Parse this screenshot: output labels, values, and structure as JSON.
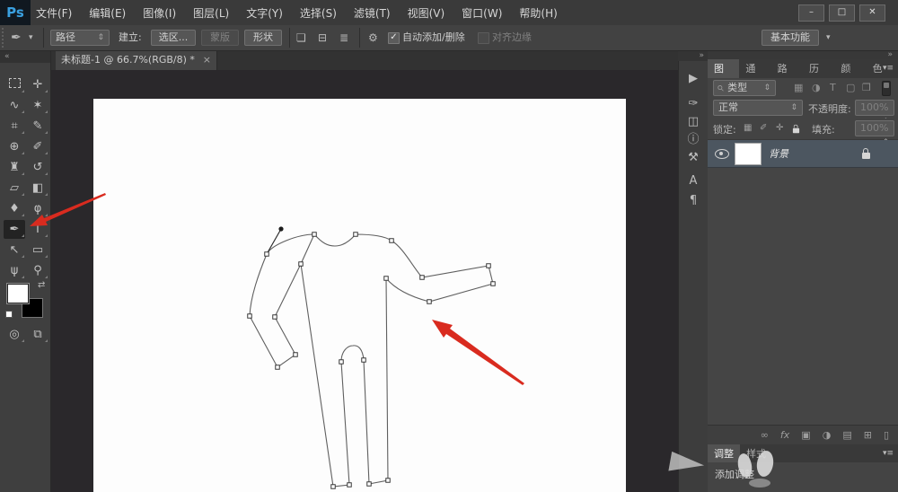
{
  "window": {
    "controls": {
      "minimize": "–",
      "maximize": "□",
      "close": "✕"
    }
  },
  "menubar": {
    "logo": "Ps",
    "items": [
      {
        "label": "文件(F)"
      },
      {
        "label": "编辑(E)"
      },
      {
        "label": "图像(I)"
      },
      {
        "label": "图层(L)"
      },
      {
        "label": "文字(Y)"
      },
      {
        "label": "选择(S)"
      },
      {
        "label": "滤镜(T)"
      },
      {
        "label": "视图(V)"
      },
      {
        "label": "窗口(W)"
      },
      {
        "label": "帮助(H)"
      }
    ]
  },
  "options_bar": {
    "tool_glyph": "✒",
    "tool_caret": "▾",
    "mode_value": "路径",
    "make_label": "建立:",
    "selection_button": "选区...",
    "mask_button": "蒙版",
    "shape_button": "形状",
    "combine_glyph": "❏",
    "align_glyph": "⊟",
    "arrange_glyph": "≣",
    "gear_glyph": "⚙",
    "auto_add_check": "✓",
    "auto_add_label": "自动添加/删除",
    "align_edges_label": "对齐边缘",
    "workspace_button": "基本功能",
    "workspace_caret": "▾"
  },
  "document_tab": {
    "title": "未标题-1 @ 66.7%(RGB/8) *",
    "close_glyph": "×"
  },
  "toolbar": {
    "collapse_glyph": "«",
    "tools": [
      {
        "name": "rectangular-marquee",
        "glyph": ""
      },
      {
        "name": "move",
        "glyph": "✛"
      },
      {
        "name": "lasso",
        "glyph": "∿"
      },
      {
        "name": "magic-wand",
        "glyph": "✶"
      },
      {
        "name": "crop",
        "glyph": "⌗"
      },
      {
        "name": "eyedropper",
        "glyph": "✎"
      },
      {
        "name": "healing-brush",
        "glyph": "⊕"
      },
      {
        "name": "brush",
        "glyph": "✐"
      },
      {
        "name": "clone-stamp",
        "glyph": "♜"
      },
      {
        "name": "history-brush",
        "glyph": "↺"
      },
      {
        "name": "eraser",
        "glyph": "▱"
      },
      {
        "name": "paint-bucket",
        "glyph": "◧"
      },
      {
        "name": "blur",
        "glyph": "♦"
      },
      {
        "name": "dodge",
        "glyph": "φ"
      },
      {
        "name": "pen",
        "glyph": "✒",
        "selected": true
      },
      {
        "name": "type",
        "glyph": "T"
      },
      {
        "name": "path-selection",
        "glyph": "↖"
      },
      {
        "name": "rectangle-shape",
        "glyph": "▭"
      },
      {
        "name": "hand",
        "glyph": "ψ"
      },
      {
        "name": "zoom",
        "glyph": "⚲"
      }
    ],
    "quick_mask_glyph": "◎",
    "screen_mode_glyph": "⧉",
    "swap_colors_glyph": "⇄"
  },
  "canvas": {
    "foreground_color": "#ffffff",
    "background_color": "#000000",
    "drawing": "pen-path-jumpsuit-outline-with-anchor-points",
    "annotations": [
      {
        "name": "red-arrow-to-pen-tool",
        "color": "#d92b1f"
      },
      {
        "name": "red-arrow-to-path-elbow",
        "color": "#d92b1f"
      }
    ]
  },
  "dock_strip": {
    "collapse_glyph": "»",
    "icons": [
      {
        "name": "actions",
        "glyph": "▶"
      },
      {
        "name": "brush-presets",
        "glyph": "✑"
      },
      {
        "name": "clone-source",
        "glyph": "◫"
      },
      {
        "name": "info",
        "glyph": "ⓘ"
      },
      {
        "name": "tool-presets",
        "glyph": "⚒"
      },
      {
        "name": "character",
        "glyph": "A"
      },
      {
        "name": "paragraph",
        "glyph": "¶"
      }
    ]
  },
  "panels": {
    "tabs": [
      {
        "label": "图层"
      },
      {
        "label": "通道"
      },
      {
        "label": "路径"
      },
      {
        "label": "历史"
      },
      {
        "label": "颜色"
      },
      {
        "label": "色板"
      }
    ],
    "menu_glyph": "▾≡",
    "filter": {
      "search_glyph": "⚲",
      "label": "类型",
      "kind_icons": [
        {
          "name": "filter-image",
          "glyph": "▦"
        },
        {
          "name": "filter-adjustment",
          "glyph": "◑"
        },
        {
          "name": "filter-type",
          "glyph": "T"
        },
        {
          "name": "filter-shape",
          "glyph": "▢"
        },
        {
          "name": "filter-smart-object",
          "glyph": "❒"
        }
      ]
    },
    "blend": {
      "mode": "正常",
      "opacity_label": "不透明度:",
      "opacity_value": "100%"
    },
    "lock": {
      "label": "锁定:",
      "icons": [
        {
          "name": "lock-transparency",
          "glyph": "▦"
        },
        {
          "name": "lock-image",
          "glyph": "✐"
        },
        {
          "name": "lock-position",
          "glyph": "✛"
        },
        {
          "name": "lock-all",
          "glyph": "⌂"
        }
      ],
      "fill_label": "填充:",
      "fill_value": "100%"
    },
    "layer": {
      "name": "背景",
      "visible": true,
      "locked": true
    },
    "bottom_icons": [
      {
        "name": "link-layers",
        "glyph": "∞"
      },
      {
        "name": "layer-effects",
        "glyph": "fx"
      },
      {
        "name": "layer-mask",
        "glyph": "▣"
      },
      {
        "name": "adjustment-layer",
        "glyph": "◑"
      },
      {
        "name": "layer-group",
        "glyph": "▤"
      },
      {
        "name": "new-layer",
        "glyph": "⊞"
      },
      {
        "name": "delete-layer",
        "glyph": "▯"
      }
    ],
    "adjust_tabs": [
      {
        "label": "调整"
      },
      {
        "label": "样式"
      }
    ],
    "add_adjustment": "添加调整"
  },
  "colors": {
    "accent_red": "#d92b1f",
    "selected_row": "#4c5660",
    "ps_blue": "#3aa0e0"
  }
}
